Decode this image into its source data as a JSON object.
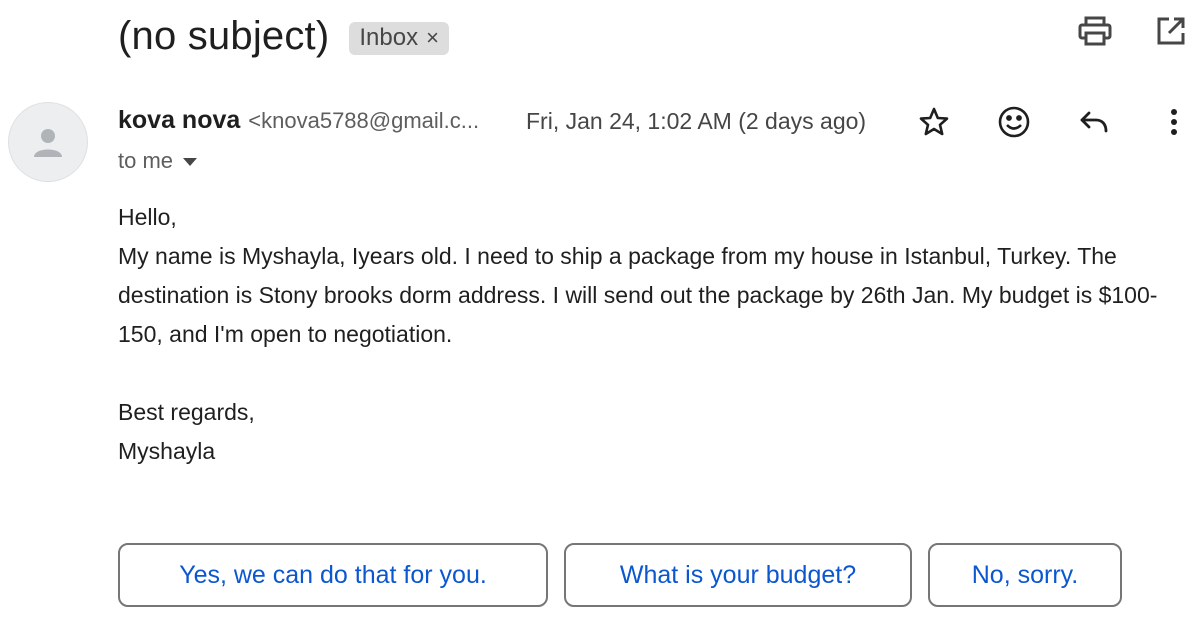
{
  "header": {
    "subject": "(no subject)",
    "label": "Inbox",
    "label_remove_glyph": "×",
    "icons": [
      "print-icon",
      "open-in-new-window-icon"
    ]
  },
  "sender": {
    "name": "kova nova",
    "email": "<knova5788@gmail.c...",
    "date": "Fri, Jan 24, 1:02 AM (2 days ago)",
    "recipient": "to me",
    "avatar_icon": "person-icon"
  },
  "actions": {
    "icons": [
      "star-icon",
      "emoji-icon",
      "reply-icon",
      "more-vert-icon"
    ]
  },
  "body": {
    "greeting": "Hello,",
    "paragraph": "My name is Myshayla, Iyears old. I need to ship a package from my house in Istanbul, Turkey. The destination is Stony brooks dorm address. I will send out the package by 26th Jan. My budget is $100-150, and I'm open to negotiation.",
    "closing": "Best regards,",
    "signature": "Myshayla"
  },
  "smart_replies": [
    {
      "label": "Yes, we can do that for you."
    },
    {
      "label": "What is your budget?"
    },
    {
      "label": "No, sorry."
    }
  ],
  "colors": {
    "accent": "#0b57d0",
    "chip_bg": "#dddddd",
    "text": "#1f1f1f",
    "muted": "#5e5e5e"
  }
}
